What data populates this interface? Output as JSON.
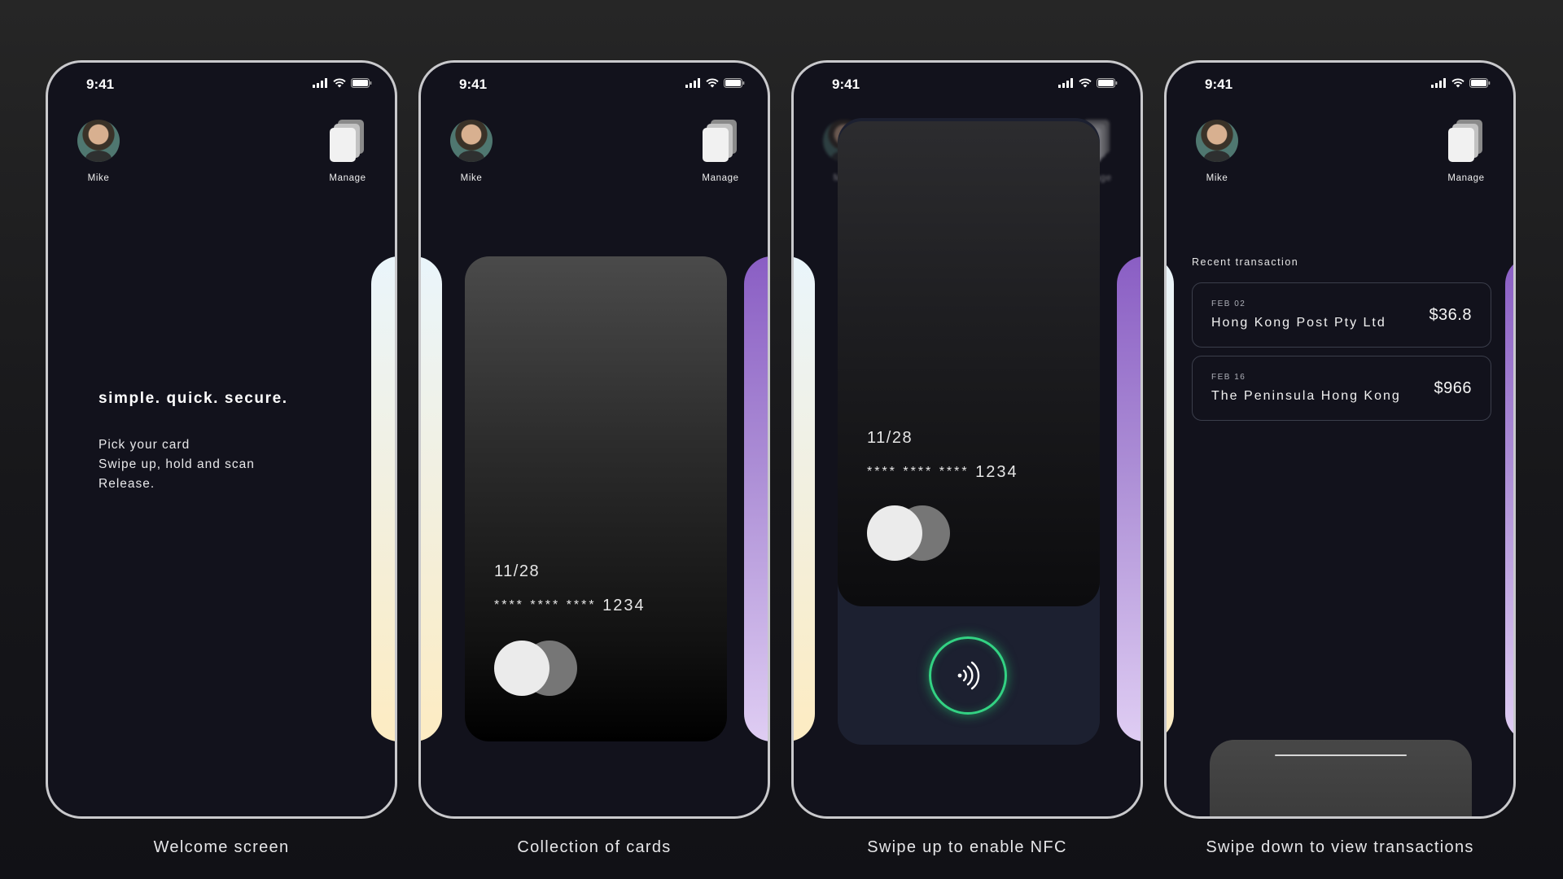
{
  "status_bar": {
    "time": "9:41"
  },
  "profile": {
    "name": "Mike",
    "manage_label": "Manage"
  },
  "screens": [
    {
      "caption": "Welcome screen",
      "headline": "simple. quick. secure.",
      "steps": [
        "Pick your card",
        "Swipe up, hold and scan",
        "Release."
      ]
    },
    {
      "caption": "Collection of cards",
      "card": {
        "expiry": "11/28",
        "masked": "**** **** ****",
        "last4": "1234"
      }
    },
    {
      "caption": "Swipe up to enable NFC",
      "card": {
        "expiry": "11/28",
        "masked": "**** **** ****",
        "last4": "1234"
      }
    },
    {
      "caption": "Swipe down to view transactions",
      "recent_title": "Recent transaction",
      "transactions": [
        {
          "date": "FEB 02",
          "merchant": "Hong Kong Post Pty Ltd",
          "amount": "$36.8"
        },
        {
          "date": "FEB 16",
          "merchant": "The Peninsula Hong Kong",
          "amount": "$966"
        }
      ]
    }
  ],
  "colors": {
    "nfc_accent": "#33d283",
    "background": "#12121c"
  },
  "icons": [
    "cellular-signal-icon",
    "wifi-icon",
    "battery-icon",
    "cards-stack-icon",
    "nfc-contactless-icon"
  ]
}
